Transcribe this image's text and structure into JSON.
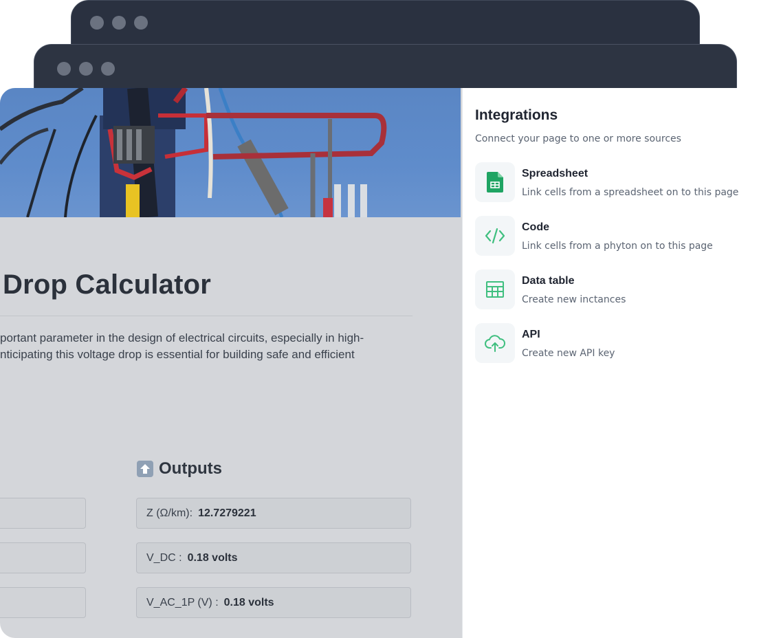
{
  "colors": {
    "window_dark": "#2a3140",
    "page_gray": "#d4d6da",
    "accent_green": "#3fbf7f",
    "sheet_green": "#1fa463"
  },
  "main": {
    "title": "Drop Calculator",
    "description_lines": [
      "portant parameter in the design of electrical circuits, especially in high-",
      "nticipating this voltage drop is essential for building safe and efficient"
    ],
    "outputs_heading": "Outputs",
    "outputs": [
      {
        "label": "Z (Ω/km):",
        "value": "12.7279221"
      },
      {
        "label": "V_DC :",
        "value": "0.18 volts"
      },
      {
        "label": "V_AC_1P (V) :",
        "value": "0.18 volts"
      }
    ]
  },
  "integrations": {
    "title": "Integrations",
    "subtitle": "Connect your page to one or more sources",
    "items": [
      {
        "title": "Spreadsheet",
        "desc": "Link cells from a spreadsheet on to this page",
        "icon": "spreadsheet-icon"
      },
      {
        "title": "Code",
        "desc": "Link cells from a phyton on to this page",
        "icon": "code-icon"
      },
      {
        "title": "Data table",
        "desc": "Create new inctances",
        "icon": "table-icon"
      },
      {
        "title": "API",
        "desc": "Create new API key",
        "icon": "cloud-upload-icon"
      }
    ]
  }
}
